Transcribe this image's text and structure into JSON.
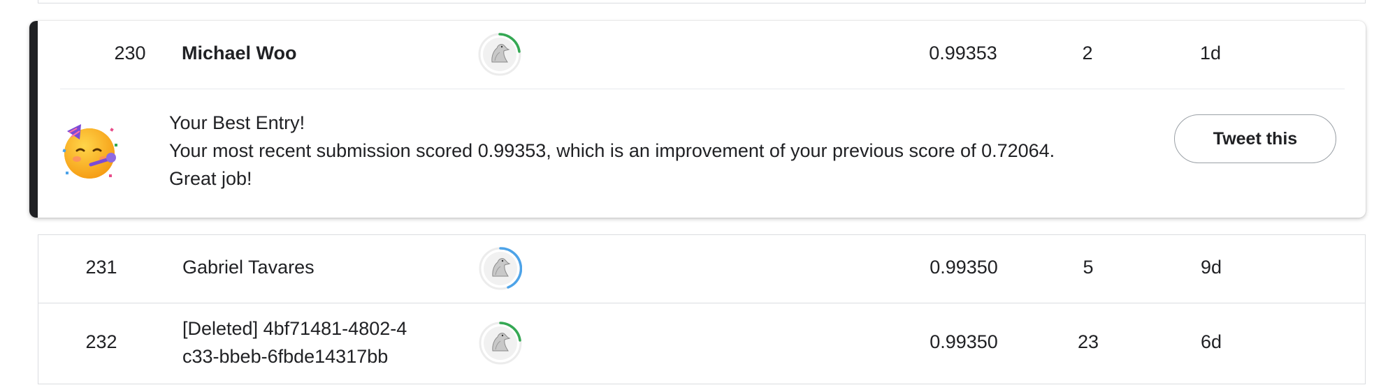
{
  "highlight": {
    "rank": "230",
    "name": "Michael Woo",
    "score": "0.99353",
    "entries": "2",
    "last": "1d",
    "message_title": "Your Best Entry!",
    "message_body": "Your most recent submission scored 0.99353, which is an improvement of your previous score of 0.72064. Great job!",
    "tweet_label": "Tweet this",
    "avatar_ring_color": "#34a853",
    "emoji_icon": "partying-face-icon"
  },
  "rows": [
    {
      "rank": "231",
      "name": "Gabriel Tavares",
      "score": "0.99350",
      "entries": "5",
      "last": "9d",
      "avatar_ring_color": "#4da3e8"
    },
    {
      "rank": "232",
      "name_line1": "[Deleted] 4bf71481-4802-4",
      "name_line2": "c33-bbeb-6fbde14317bb",
      "score": "0.99350",
      "entries": "23",
      "last": "6d",
      "avatar_ring_color": "#34a853"
    }
  ],
  "colors": {
    "accent_bar": "#202124",
    "border": "#dadce0"
  }
}
